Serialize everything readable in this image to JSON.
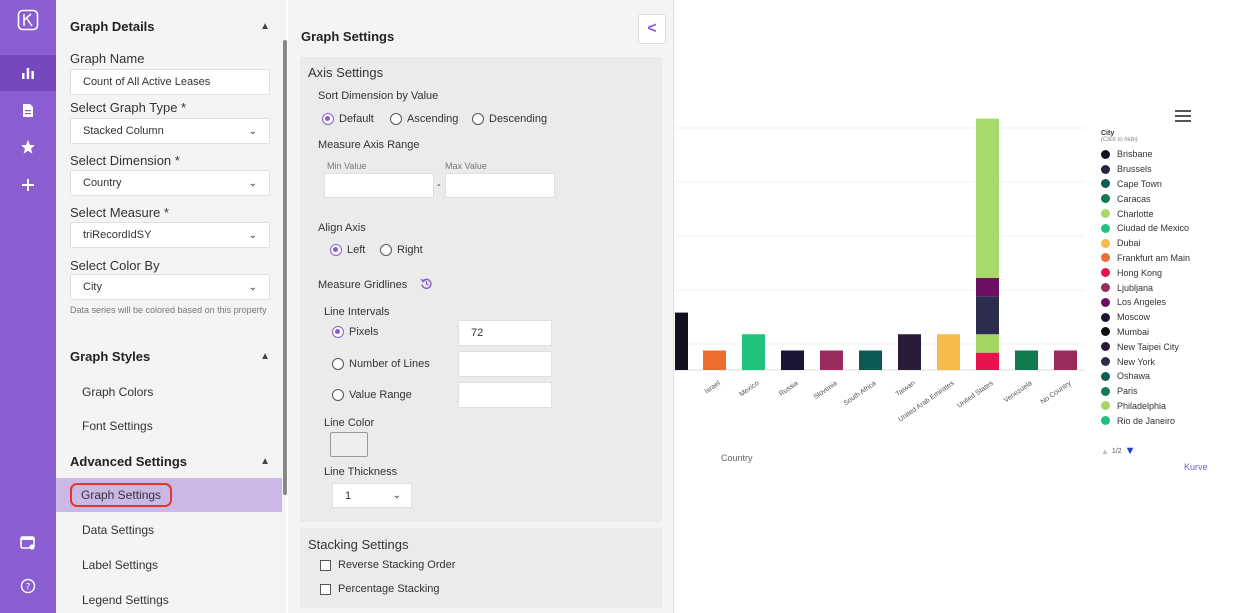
{
  "rail": {
    "icons": [
      "logo-icon",
      "bar-chart-icon",
      "document-icon",
      "star-icon",
      "plus-icon",
      "dashboard-settings-icon",
      "help-icon"
    ]
  },
  "left_panel": {
    "graph_details": {
      "title": "Graph Details",
      "graph_name_label": "Graph Name",
      "graph_name_value": "Count of All Active Leases",
      "graph_type_label": "Select Graph Type *",
      "graph_type_value": "Stacked Column",
      "dimension_label": "Select Dimension *",
      "dimension_value": "Country",
      "measure_label": "Select Measure *",
      "measure_value": "triRecordIdSY",
      "color_by_label": "Select Color By",
      "color_by_value": "City",
      "color_by_help": "Data series will be colored based on this property"
    },
    "graph_styles": {
      "title": "Graph Styles",
      "items": [
        "Graph Colors",
        "Font Settings"
      ]
    },
    "advanced_settings": {
      "title": "Advanced Settings",
      "items": [
        "Graph Settings",
        "Data Settings",
        "Label Settings",
        "Legend Settings"
      ],
      "active": "Graph Settings"
    }
  },
  "graph_settings": {
    "title": "Graph Settings",
    "collapse_glyph": "<",
    "axis_settings": {
      "title": "Axis Settings",
      "sort_label": "Sort Dimension by Value",
      "sort_options": [
        "Default",
        "Ascending",
        "Descending"
      ],
      "sort_selected": "Default",
      "range_label": "Measure Axis Range",
      "min_label": "Min Value",
      "max_label": "Max Value",
      "min_value": "",
      "max_value": "",
      "range_separator": "-",
      "align_label": "Align Axis",
      "align_options": [
        "Left",
        "Right"
      ],
      "align_selected": "Left",
      "gridlines_label": "Measure Gridlines",
      "intervals_label": "Line Intervals",
      "interval_options": [
        "Pixels",
        "Number of Lines",
        "Value Range"
      ],
      "interval_selected": "Pixels",
      "pixels_value": "72",
      "line_color_label": "Line Color",
      "line_color_value": "#eeeeee",
      "thickness_label": "Line Thickness",
      "thickness_value": "1"
    },
    "stacking_settings": {
      "title": "Stacking Settings",
      "options": [
        "Reverse Stacking Order",
        "Percentage Stacking"
      ]
    }
  },
  "chart_data": {
    "type": "bar",
    "stacked": true,
    "xlabel": "Country",
    "ylabel": "",
    "grid": true,
    "legend_placement": "right",
    "categories": [
      "Israel",
      "Mexico",
      "Russia",
      "Slovenia",
      "South Africa",
      "Taiwan",
      "United Arab Emirates",
      "United States",
      "Venezuela",
      "No Country"
    ],
    "partial_bar": {
      "color": "#15101f",
      "value": 5.3
    },
    "bars": [
      {
        "category": "Israel",
        "segments": [
          {
            "city": "Frankfurt am Main",
            "value": 1.8
          }
        ]
      },
      {
        "category": "Mexico",
        "segments": [
          {
            "city": "Ciudad de Mexico",
            "value": 3.3
          }
        ]
      },
      {
        "category": "Russia",
        "segments": [
          {
            "city": "Moscow",
            "value": 1.8
          }
        ]
      },
      {
        "category": "Slovenia",
        "segments": [
          {
            "city": "Ljubljana",
            "value": 1.8
          }
        ]
      },
      {
        "category": "South Africa",
        "segments": [
          {
            "city": "Cape Town",
            "value": 1.8
          }
        ]
      },
      {
        "category": "Taiwan",
        "segments": [
          {
            "city": "New Taipei City",
            "value": 3.3
          }
        ]
      },
      {
        "category": "United Arab Emirates",
        "segments": [
          {
            "city": "Dubai",
            "value": 3.3
          }
        ]
      },
      {
        "category": "United States",
        "segments": [
          {
            "city": "Hong Kong",
            "value": 1.6
          },
          {
            "city": "Philadelphia",
            "value": 1.7
          },
          {
            "city": "New York",
            "value": 3.5
          },
          {
            "city": "Los Angeles",
            "value": 1.7
          },
          {
            "city": "Charlotte",
            "value": 14.7
          }
        ]
      },
      {
        "category": "Venezuela",
        "segments": [
          {
            "city": "Caracas",
            "value": 1.8
          }
        ]
      },
      {
        "category": "No Country",
        "segments": [
          {
            "city": "Ljubljana",
            "value": 1.8
          }
        ]
      }
    ],
    "ylim": [
      0,
      24
    ]
  },
  "legend": {
    "title": "City",
    "subtitle": "(Click to hide)",
    "items": [
      {
        "name": "Brisbane",
        "color": "#15101f"
      },
      {
        "name": "Brussels",
        "color": "#262444"
      },
      {
        "name": "Cape Town",
        "color": "#0d5a55"
      },
      {
        "name": "Caracas",
        "color": "#117a4f"
      },
      {
        "name": "Charlotte",
        "color": "#a7d96a"
      },
      {
        "name": "Ciudad de Mexico",
        "color": "#20c27c"
      },
      {
        "name": "Dubai",
        "color": "#f5bb4c"
      },
      {
        "name": "Frankfurt am Main",
        "color": "#ee6c2d"
      },
      {
        "name": "Hong Kong",
        "color": "#e8134d"
      },
      {
        "name": "Ljubljana",
        "color": "#9b2a5e"
      },
      {
        "name": "Los Angeles",
        "color": "#6d0f61"
      },
      {
        "name": "Moscow",
        "color": "#1b1435"
      },
      {
        "name": "Mumbai",
        "color": "#111111"
      },
      {
        "name": "New Taipei City",
        "color": "#2a1c38"
      },
      {
        "name": "New York",
        "color": "#2c2c4f"
      },
      {
        "name": "Oshawa",
        "color": "#0b5c56"
      },
      {
        "name": "Paris",
        "color": "#127a4e"
      },
      {
        "name": "Philadelphia",
        "color": "#a5d663"
      },
      {
        "name": "Rio de Janeiro",
        "color": "#1fbf82"
      }
    ],
    "pager": "1/2",
    "credit": "Kurve"
  }
}
